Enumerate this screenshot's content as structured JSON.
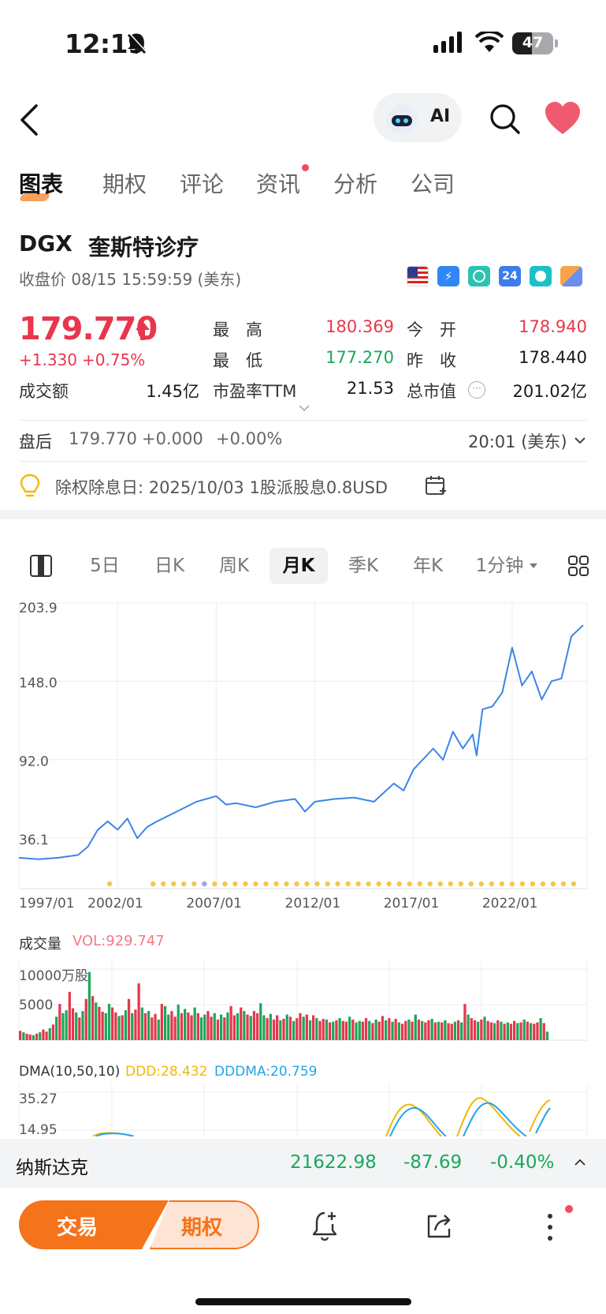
{
  "status": {
    "time": "12:19",
    "battery": "47"
  },
  "nav": {
    "ai_label": "AI"
  },
  "tabs": [
    {
      "label": "图表",
      "active": true
    },
    {
      "label": "期权"
    },
    {
      "label": "评论"
    },
    {
      "label": "资讯",
      "dot": true
    },
    {
      "label": "分析"
    },
    {
      "label": "公司"
    }
  ],
  "stock": {
    "ticker": "DGX",
    "name": "奎斯特诊疗",
    "close_time": "收盘价 08/15 15:59:59 (美东)",
    "price": "179.770",
    "change": "+1.330",
    "change_pct": "+0.75%",
    "high_label": "最　高",
    "high": "180.369",
    "open_label": "今　开",
    "open": "178.940",
    "low_label": "最　低",
    "low": "177.270",
    "prev_label": "昨　收",
    "prev": "178.440",
    "turnover_label": "成交额",
    "turnover": "1.45亿",
    "pe_label": "市盈率TTM",
    "pe": "21.53",
    "mcap_label": "总市值",
    "mcap": "201.02亿"
  },
  "after_hours": {
    "label": "盘后",
    "price": "179.770",
    "change": "+0.000",
    "change_pct": "+0.00%",
    "time": "20:01 (美东)"
  },
  "dividend": {
    "text": "除权除息日: 2025/10/03 1股派股息0.8USD"
  },
  "periods": [
    {
      "label": "5日"
    },
    {
      "label": "日K"
    },
    {
      "label": "周K"
    },
    {
      "label": "月K",
      "active": true
    },
    {
      "label": "季K"
    },
    {
      "label": "年K"
    },
    {
      "label": "1分钟"
    }
  ],
  "chart_data": [
    {
      "type": "line",
      "y_ticks": [
        "203.9",
        "148.0",
        "92.0",
        "36.1"
      ],
      "x_ticks": [
        "1997/01",
        "2002/01",
        "2007/01",
        "2012/01",
        "2017/01",
        "2022/01"
      ],
      "ylim": [
        0,
        203.9
      ],
      "series": [
        {
          "color": "#3a86e8",
          "x": [
            1997.0,
            1998.0,
            1999.0,
            2000.0,
            2000.5,
            2001.0,
            2001.5,
            2002.0,
            2002.5,
            2003.0,
            2003.5,
            2004.0,
            2005.0,
            2006.0,
            2007.0,
            2007.5,
            2008.0,
            2009.0,
            2010.0,
            2011.0,
            2011.5,
            2012.0,
            2013.0,
            2014.0,
            2015.0,
            2016.0,
            2016.5,
            2017.0,
            2018.0,
            2018.5,
            2019.0,
            2019.5,
            2020.0,
            2020.2,
            2020.5,
            2021.0,
            2021.5,
            2022.0,
            2022.5,
            2023.0,
            2023.5,
            2024.0,
            2024.5,
            2025.0,
            2025.6
          ],
          "values": [
            22,
            21,
            22,
            24,
            30,
            42,
            48,
            42,
            50,
            36,
            44,
            48,
            55,
            62,
            66,
            60,
            61,
            58,
            62,
            64,
            55,
            62,
            64,
            65,
            62,
            75,
            70,
            85,
            100,
            92,
            112,
            100,
            110,
            95,
            128,
            130,
            140,
            172,
            145,
            155,
            135,
            148,
            150,
            180,
            188
          ]
        }
      ]
    },
    {
      "type": "bar",
      "title": "成交量",
      "indicator": "VOL:929.747",
      "y_ticks": [
        "10000万股",
        "5000"
      ],
      "ylim": [
        0,
        10000
      ],
      "values_10k_shares": [
        1300,
        1100,
        900,
        800,
        700,
        900,
        1100,
        1500,
        1200,
        1700,
        2200,
        3300,
        5100,
        3800,
        4200,
        6800,
        4500,
        3900,
        3200,
        4100,
        5800,
        9600,
        6200,
        5300,
        4700,
        4000,
        3800,
        5100,
        4600,
        3900,
        3400,
        3500,
        4200,
        5800,
        3800,
        4300,
        8000,
        4600,
        3800,
        4100,
        3200,
        3700,
        2900,
        5100,
        4800,
        3600,
        4100,
        3300,
        5000,
        3800,
        4400,
        3900,
        3500,
        4600,
        3800,
        3200,
        3600,
        4100,
        3300,
        3800,
        2900,
        3600,
        3200,
        3900,
        4800,
        3500,
        3800,
        4600,
        4100,
        3600,
        3400,
        4100,
        3800,
        5200,
        3500,
        3100,
        3700,
        2900,
        3500,
        2800,
        3000,
        3600,
        3300,
        2700,
        3100,
        3800,
        3300,
        3600,
        2800,
        3500,
        3100,
        2700,
        3000,
        2900,
        2500,
        2600,
        2800,
        3100,
        2700,
        2600,
        3300,
        2900,
        2500,
        2700,
        2600,
        3100,
        2700,
        2400,
        2900,
        2600,
        3400,
        2800,
        3100,
        2600,
        3000,
        2500,
        2300,
        2700,
        2900,
        2600,
        3600,
        2900,
        2700,
        2500,
        2800,
        3000,
        2500,
        2600,
        2500,
        2800,
        2400,
        2300,
        2600,
        2800,
        2500,
        5100,
        3600,
        3100,
        2800,
        2600,
        2900,
        3300,
        2700,
        2500,
        2400,
        2800,
        2600,
        2300,
        2500,
        2300,
        2700,
        2400,
        2500,
        2900,
        2600,
        2400,
        2300,
        2500,
        3100,
        2400,
        1200
      ],
      "colors_up": [
        1,
        0,
        1,
        1,
        0,
        1,
        0,
        1,
        1,
        0,
        1,
        0,
        1,
        0,
        0,
        1,
        1,
        0,
        1,
        0,
        1,
        0,
        1,
        0,
        1,
        1,
        0,
        0,
        1,
        1,
        0,
        1,
        0,
        1,
        0,
        1,
        1,
        0,
        1,
        0,
        1,
        1,
        0,
        1,
        0,
        0,
        1,
        1,
        0,
        1,
        0,
        1,
        1,
        0,
        1,
        0,
        0,
        1,
        1,
        0,
        1,
        0,
        1,
        0,
        1,
        1,
        0,
        1,
        0,
        1,
        0,
        1,
        1,
        0,
        0,
        1,
        0,
        1,
        1,
        0,
        1,
        0,
        1,
        0,
        1,
        1,
        0,
        1,
        0,
        1,
        0,
        1,
        1,
        0,
        1,
        0,
        1,
        0,
        1,
        1,
        0,
        1,
        0,
        0,
        1,
        1,
        0,
        1,
        0,
        1,
        1,
        0,
        1,
        0,
        1,
        0,
        1,
        1,
        0,
        1,
        0,
        1,
        0,
        1,
        1,
        0,
        1,
        0,
        1,
        0,
        1,
        1,
        0,
        1,
        0,
        1,
        0,
        1,
        1,
        0,
        1,
        0,
        1,
        1,
        0,
        1,
        0,
        1,
        0,
        1,
        1,
        0,
        1,
        0,
        1,
        0,
        1,
        1,
        0,
        1,
        0
      ]
    },
    {
      "type": "line",
      "title": "DMA(10,50,10)",
      "series": [
        {
          "name": "DDD:28.432",
          "color": "#f2b705"
        },
        {
          "name": "DDDMA:20.759",
          "color": "#23a5e8"
        }
      ],
      "y_ticks": [
        "35.27",
        "14.95"
      ]
    }
  ],
  "ticker_bar": {
    "name": "纳斯达克",
    "value": "21622.98",
    "change": "-87.69",
    "change_pct": "-0.40%"
  },
  "bottom": {
    "trade_label": "交易",
    "options_label": "期权"
  },
  "colors": {
    "accent": "#f5731b",
    "up": "#e8364d",
    "down": "#1aa85a"
  }
}
